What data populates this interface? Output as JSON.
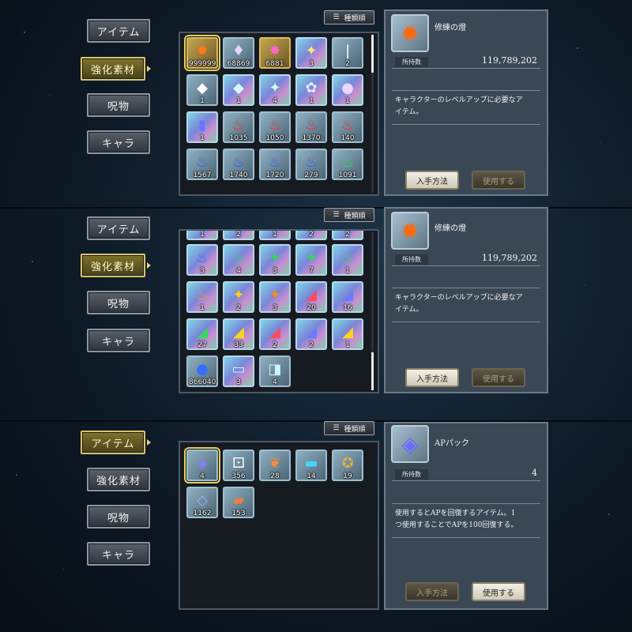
{
  "nav": {
    "item": "アイテム",
    "material": "強化素材",
    "curse": "呪物",
    "character": "キャラ"
  },
  "sort": {
    "label": "種類順"
  },
  "actions": {
    "obtain": "入手方法",
    "use": "使用する"
  },
  "panel1": {
    "active_tab": "material",
    "tiles": [
      {
        "icon": "✹",
        "color": "#ff7a1a",
        "count": "999999",
        "frame": "gold",
        "selected": true
      },
      {
        "icon": "♦",
        "color": "#e6d6ff",
        "count": "68869",
        "frame": "normal"
      },
      {
        "icon": "✸",
        "color": "#ff66cc",
        "count": "6881",
        "frame": "gold"
      },
      {
        "icon": "✦",
        "color": "#ffe27a",
        "count": "3",
        "frame": "rainbow"
      },
      {
        "icon": "❘",
        "color": "#ffffff",
        "count": "2",
        "frame": "normal"
      },
      {
        "icon": "◆",
        "color": "#ffffff",
        "count": "1",
        "frame": "normal"
      },
      {
        "icon": "◆",
        "color": "#d8f6ff",
        "count": "1",
        "frame": "rainbow"
      },
      {
        "icon": "✦",
        "color": "#c9fff2",
        "count": "4",
        "frame": "rainbow"
      },
      {
        "icon": "✿",
        "color": "#e2e9ff",
        "count": "1",
        "frame": "rainbow"
      },
      {
        "icon": "●",
        "color": "#e8d8ff",
        "count": "1",
        "frame": "rainbow"
      },
      {
        "icon": "▮",
        "color": "#6a76ff",
        "count": "1",
        "frame": "rainbow"
      },
      {
        "icon": "♨",
        "color": "#ff2a3a",
        "count": "1035",
        "frame": "normal"
      },
      {
        "icon": "♨",
        "color": "#ff2a3a",
        "count": "1050",
        "frame": "normal"
      },
      {
        "icon": "♨",
        "color": "#ff2a3a",
        "count": "1370",
        "frame": "normal"
      },
      {
        "icon": "♨",
        "color": "#ff2a3a",
        "count": "140",
        "frame": "normal"
      },
      {
        "icon": "♨",
        "color": "#3a5cff",
        "count": "1567",
        "frame": "normal"
      },
      {
        "icon": "♨",
        "color": "#3a5cff",
        "count": "1740",
        "frame": "normal"
      },
      {
        "icon": "♨",
        "color": "#3a5cff",
        "count": "1720",
        "frame": "normal"
      },
      {
        "icon": "♨",
        "color": "#3a5cff",
        "count": "279",
        "frame": "normal"
      },
      {
        "icon": "♨",
        "color": "#3ad84a",
        "count": "1091",
        "frame": "normal"
      }
    ],
    "detail": {
      "icon": "✹",
      "icon_color": "#ff6a10",
      "name": "修練の燈",
      "owned_label": "所持数",
      "owned_value": "119,789,202",
      "desc_line1": "キャラクターのレベルアップに必要なア",
      "desc_line2": "イテム。"
    }
  },
  "panel2": {
    "active_tab": "material",
    "top_counts": [
      "1",
      "2",
      "1",
      "2",
      "2"
    ],
    "tiles": [
      {
        "icon": "♨",
        "color": "#3a6cff",
        "count": "3",
        "frame": "rainbow"
      },
      {
        "icon": "♨",
        "color": "#35d85a",
        "count": "4",
        "frame": "rainbow"
      },
      {
        "icon": "✦",
        "color": "#35d85a",
        "count": "3",
        "frame": "rainbow"
      },
      {
        "icon": "✦",
        "color": "#35d85a",
        "count": "7",
        "frame": "rainbow"
      },
      {
        "icon": "♨",
        "color": "#35d85a",
        "count": "1",
        "frame": "rainbow"
      },
      {
        "icon": "♨",
        "color": "#ff9a1a",
        "count": "1",
        "frame": "rainbow"
      },
      {
        "icon": "✦",
        "color": "#ffcc1a",
        "count": "2",
        "frame": "rainbow"
      },
      {
        "icon": "✦",
        "color": "#ff8a1a",
        "count": "3",
        "frame": "rainbow"
      },
      {
        "icon": "◢",
        "color": "#ff4a5a",
        "count": "20",
        "frame": "rainbow"
      },
      {
        "icon": "◢",
        "color": "#6a7aff",
        "count": "16",
        "frame": "rainbow"
      },
      {
        "icon": "◢",
        "color": "#35d85a",
        "count": "27",
        "frame": "rainbow"
      },
      {
        "icon": "◢",
        "color": "#ffd21a",
        "count": "33",
        "frame": "rainbow"
      },
      {
        "icon": "◢",
        "color": "#ff4a5a",
        "count": "2",
        "frame": "rainbow"
      },
      {
        "icon": "◢",
        "color": "#6a7aff",
        "count": "2",
        "frame": "rainbow"
      },
      {
        "icon": "◢",
        "color": "#ffd21a",
        "count": "1",
        "frame": "rainbow"
      },
      {
        "icon": "●",
        "color": "#3a6cff",
        "count": "866040",
        "frame": "normal"
      },
      {
        "icon": "▭",
        "color": "#c9f3ff",
        "count": "3",
        "frame": "rainbow"
      },
      {
        "icon": "◨",
        "color": "#c9f3ff",
        "count": "4",
        "frame": "normal"
      }
    ],
    "detail": {
      "icon": "✹",
      "icon_color": "#ff6a10",
      "name": "修練の燈",
      "owned_label": "所持数",
      "owned_value": "119,789,202",
      "desc_line1": "キャラクターのレベルアップに必要なア",
      "desc_line2": "イテム。"
    }
  },
  "panel3": {
    "active_tab": "item",
    "tiles": [
      {
        "icon": "◈",
        "color": "#8a7cff",
        "count": "4",
        "frame": "normal",
        "selected": true
      },
      {
        "icon": "⚀",
        "color": "#ffffff",
        "count": "356",
        "frame": "normal"
      },
      {
        "icon": "❦",
        "color": "#ff8a3a",
        "count": "28",
        "frame": "normal"
      },
      {
        "icon": "▬",
        "color": "#4ad2ff",
        "count": "14",
        "frame": "normal"
      },
      {
        "icon": "✪",
        "color": "#d8b04a",
        "count": "19",
        "frame": "normal"
      },
      {
        "icon": "◇",
        "color": "#9ab0ff",
        "count": "1162",
        "frame": "normal"
      },
      {
        "icon": "▰",
        "color": "#ff7a3a",
        "count": "153",
        "frame": "normal"
      }
    ],
    "detail": {
      "icon": "◈",
      "icon_color": "#6a6cff",
      "name": "APパック",
      "owned_label": "所持数",
      "owned_value": "4",
      "desc_line1": "使用するとAPを回復するアイテム。1",
      "desc_line2": "つ使用することでAPを100回復する。"
    }
  }
}
